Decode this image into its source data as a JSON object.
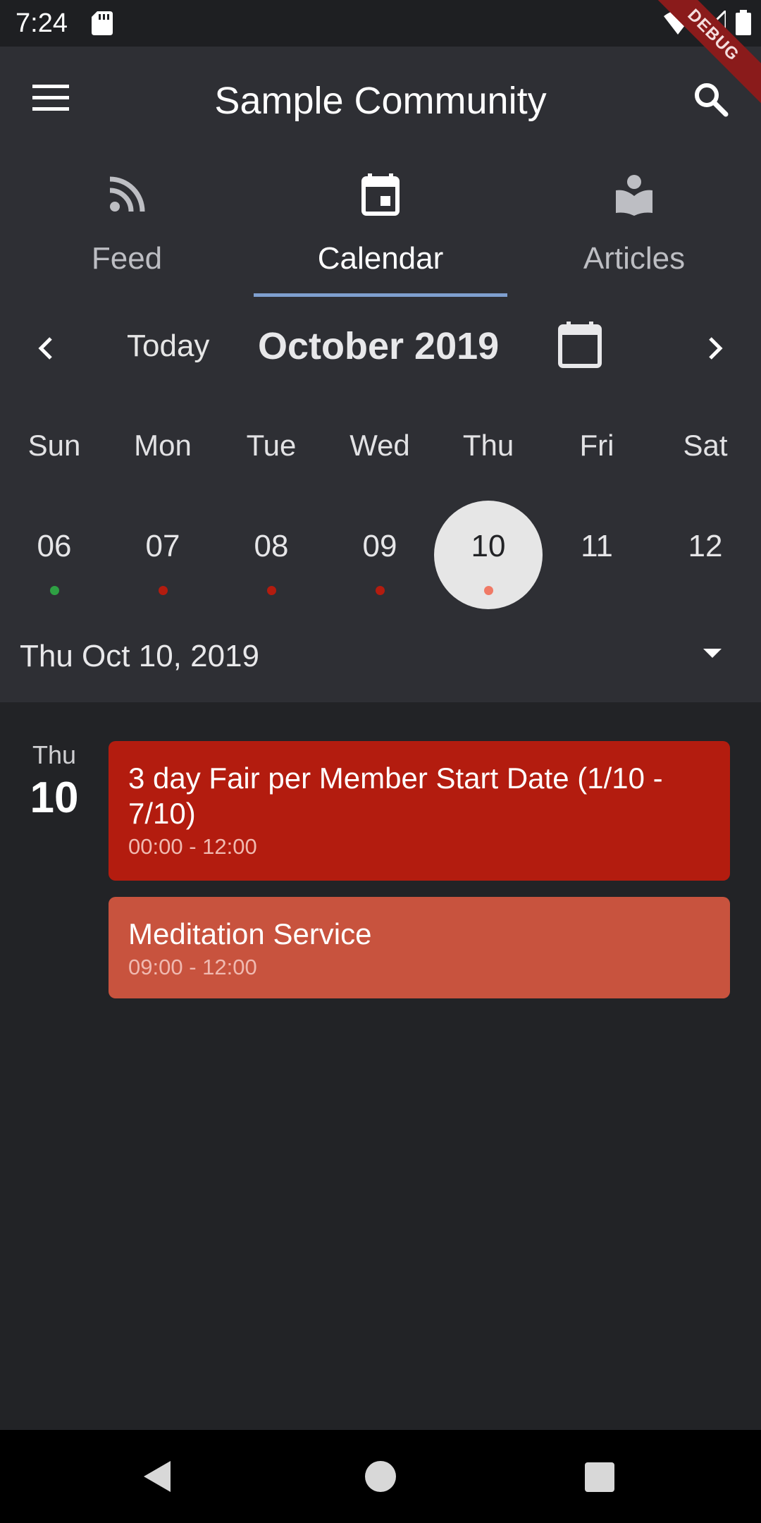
{
  "status_bar": {
    "time": "7:24"
  },
  "debug_banner": "DEBUG",
  "app_bar": {
    "title": "Sample Community"
  },
  "tabs": [
    {
      "label": "Feed",
      "icon": "rss-icon",
      "active": false
    },
    {
      "label": "Calendar",
      "icon": "calendar-icon",
      "active": true
    },
    {
      "label": "Articles",
      "icon": "reader-icon",
      "active": false
    }
  ],
  "calendar": {
    "today_label": "Today",
    "month_title": "October 2019",
    "weekdays": [
      "Sun",
      "Mon",
      "Tue",
      "Wed",
      "Thu",
      "Fri",
      "Sat"
    ],
    "days": [
      {
        "num": "06",
        "dot": "#2ea043"
      },
      {
        "num": "07",
        "dot": "#b31c0f"
      },
      {
        "num": "08",
        "dot": "#b31c0f"
      },
      {
        "num": "09",
        "dot": "#b31c0f"
      },
      {
        "num": "10",
        "dot": "#f07a66",
        "selected": true
      },
      {
        "num": "11",
        "dot": null
      },
      {
        "num": "12",
        "dot": null
      }
    ],
    "selected_date": "Thu Oct 10, 2019"
  },
  "events": {
    "day_of_week": "Thu",
    "day_number": "10",
    "items": [
      {
        "title": "3 day Fair per Member Start Date (1/10 - 7/10)",
        "time": "00:00 - 12:00",
        "color": "#b31c0f"
      },
      {
        "title": "Meditation Service",
        "time": "09:00 - 12:00",
        "color": "#c8533e"
      }
    ]
  }
}
